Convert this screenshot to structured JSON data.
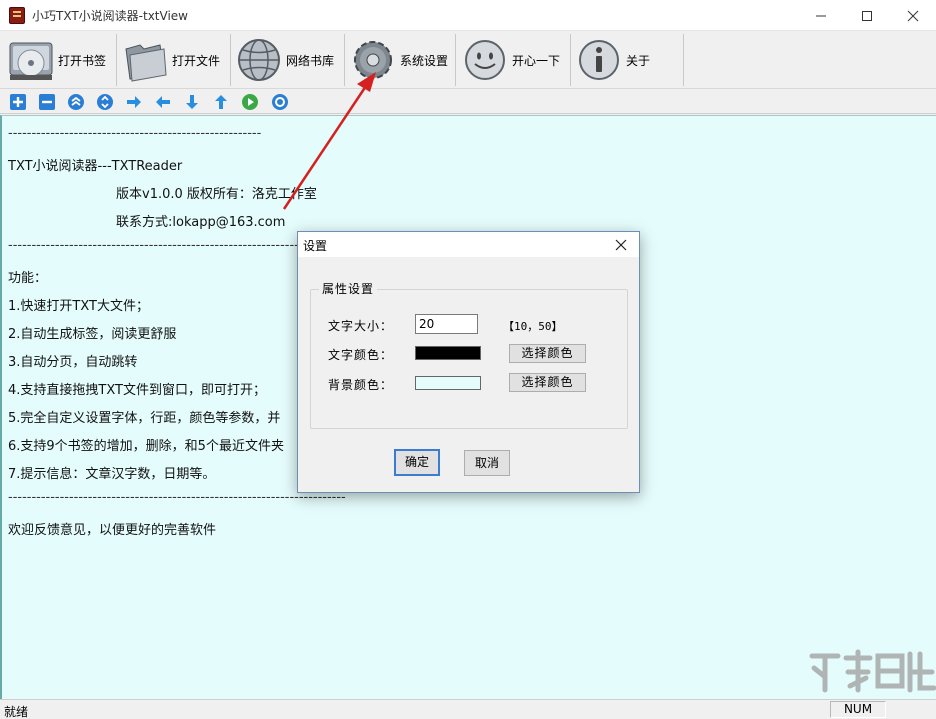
{
  "window": {
    "title": "小巧TXT小说阅读器-txtView"
  },
  "toolbar": {
    "open_bookmark": "打开书签",
    "open_file": "打开文件",
    "online_library": "网络书库",
    "settings": "系统设置",
    "fun": "开心一下",
    "about": "关于"
  },
  "content": {
    "rule1": "------------------------------------------------------",
    "app_name": "TXT小说阅读器---TXTReader",
    "version_line": "版本v1.0.0 版权所有：洛克工作室",
    "contact_line": "联系方式:lokapp@163.com",
    "rule2": "------------------------------------------------------------------------",
    "features_title": "功能：",
    "feature_1": "1.快速打开TXT大文件；",
    "feature_2": "2.自动生成标签，阅读更舒服",
    "feature_3": "3.自动分页，自动跳转",
    "feature_4": "4.支持直接拖拽TXT文件到窗口，即可打开；",
    "feature_5": "5.完全自定义设置字体，行距，颜色等参数，并",
    "feature_6": "6.支持9个书签的增加，删除，和5个最近文件夹",
    "feature_7": "7.提示信息：文章汉字数，日期等。",
    "rule3": "------------------------------------------------------------------------",
    "feedback": "欢迎反馈意见，以便更好的完善软件"
  },
  "dialog": {
    "title": "设置",
    "group_label": "属性设置",
    "font_size_label": "文字大小：",
    "font_size_value": "20",
    "font_size_range": "【10，50】",
    "font_color_label": "文字颜色：",
    "bg_color_label": "背景颜色：",
    "pick_color": "选择颜色",
    "ok": "确定",
    "cancel": "取消"
  },
  "colors": {
    "font_color": "#000000",
    "bg_color": "#e5fcfc",
    "annotation_arrow": "#d42020"
  },
  "statusbar": {
    "left": "就绪",
    "num": "NUM"
  },
  "icons": {
    "small_toolbar": [
      "plus-icon",
      "minus-icon",
      "collapse-icon",
      "up-down-icon",
      "arrow-right-icon",
      "arrow-left-icon",
      "arrow-down-icon",
      "arrow-up-icon",
      "play-icon",
      "refresh-icon"
    ]
  }
}
